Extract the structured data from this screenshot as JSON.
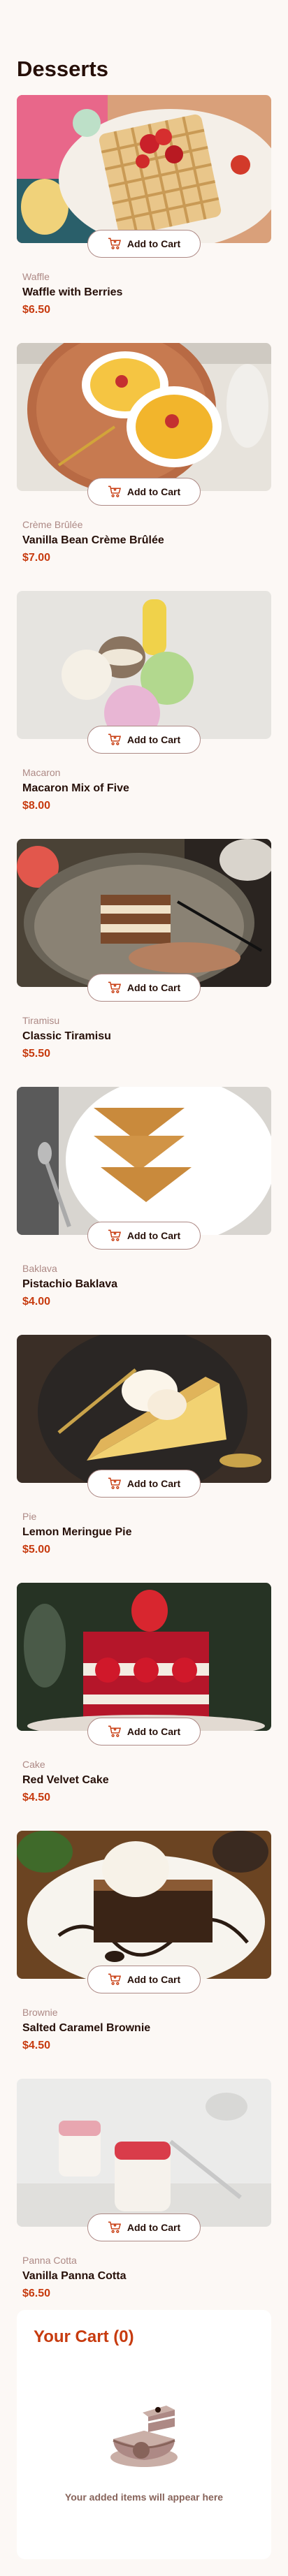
{
  "page": {
    "title": "Desserts"
  },
  "add_to_cart_label": "Add to Cart",
  "products": [
    {
      "category": "Waffle",
      "name": "Waffle with Berries",
      "price": "$6.50",
      "image_icon": "waffle-image"
    },
    {
      "category": "Crème Brûlée",
      "name": "Vanilla Bean Crème Brûlée",
      "price": "$7.00",
      "image_icon": "creme-brulee-image"
    },
    {
      "category": "Macaron",
      "name": "Macaron Mix of Five",
      "price": "$8.00",
      "image_icon": "macaron-image"
    },
    {
      "category": "Tiramisu",
      "name": "Classic Tiramisu",
      "price": "$5.50",
      "image_icon": "tiramisu-image"
    },
    {
      "category": "Baklava",
      "name": "Pistachio Baklava",
      "price": "$4.00",
      "image_icon": "baklava-image"
    },
    {
      "category": "Pie",
      "name": "Lemon Meringue Pie",
      "price": "$5.00",
      "image_icon": "pie-image"
    },
    {
      "category": "Cake",
      "name": "Red Velvet Cake",
      "price": "$4.50",
      "image_icon": "cake-image"
    },
    {
      "category": "Brownie",
      "name": "Salted Caramel Brownie",
      "price": "$4.50",
      "image_icon": "brownie-image"
    },
    {
      "category": "Panna Cotta",
      "name": "Vanilla Panna Cotta",
      "price": "$6.50",
      "image_icon": "panna-cotta-image"
    }
  ],
  "cart": {
    "title": "Your Cart (0)",
    "empty_message": "Your added items will appear here",
    "empty_icon": "empty-cake-icon"
  },
  "colors": {
    "accent": "#c73b0f",
    "text": "#260f08",
    "muted": "#ad8985",
    "background": "#fcf8f5"
  }
}
